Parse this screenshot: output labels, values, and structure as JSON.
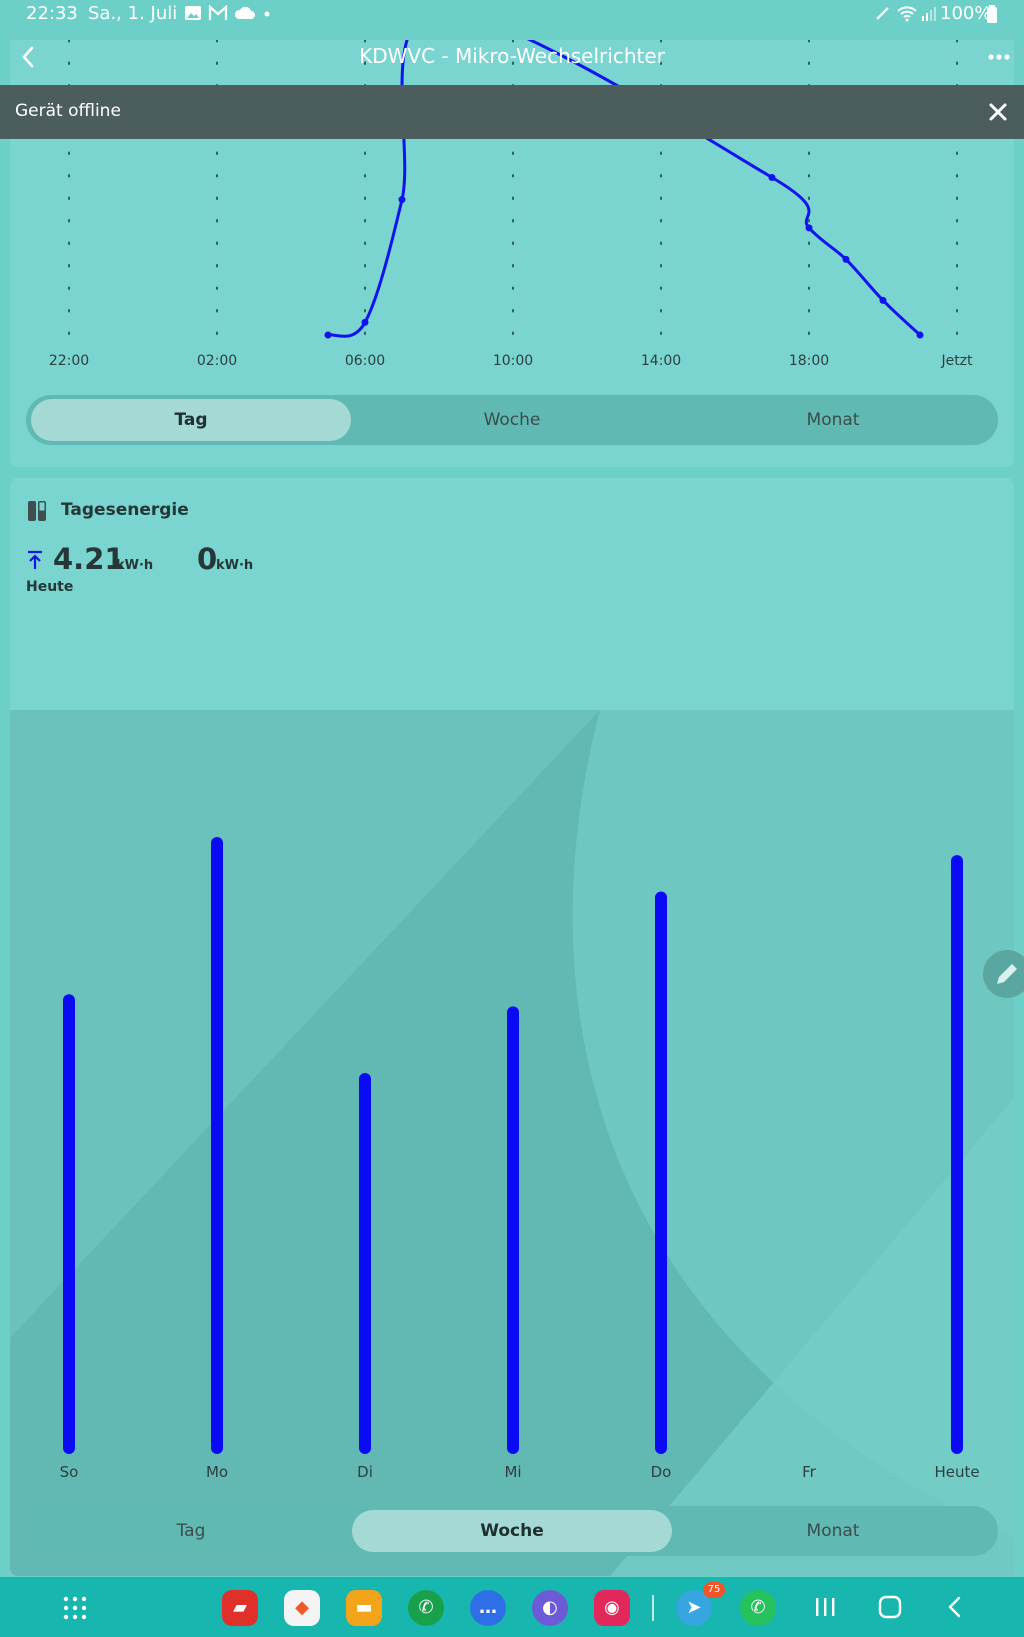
{
  "status_bar": {
    "time": "22:33",
    "date": "Sa., 1. Juli",
    "battery": "100%",
    "icons": [
      "image-icon",
      "mail-icon",
      "cloud-icon",
      "dot-icon",
      "pen-icon",
      "wifi-icon",
      "signal-icon",
      "battery-icon"
    ]
  },
  "header": {
    "title": "KDWVC - Mikro-Wechselrichter",
    "back_icon": "chevron-left-icon",
    "more_icon": "more-icon"
  },
  "banner": {
    "text": "Gerät offline",
    "close_icon": "close-icon"
  },
  "power_chart": {
    "tabs": [
      {
        "label": "Tag",
        "active": true
      },
      {
        "label": "Woche",
        "active": false
      },
      {
        "label": "Monat",
        "active": false
      }
    ]
  },
  "energy_card": {
    "title": "Tagesenergie",
    "icon": "bar-chart-icon",
    "today_value": "4.21",
    "today_unit": "kW·h",
    "today_label": "Heute",
    "today_icon": "arrow-up-to-line-icon",
    "second_value": "0",
    "second_unit": "kW·h",
    "tabs": [
      {
        "label": "Tag",
        "active": false
      },
      {
        "label": "Woche",
        "active": true
      },
      {
        "label": "Monat",
        "active": false
      }
    ],
    "edit_icon": "pencil-icon"
  },
  "chart_data": [
    {
      "type": "line",
      "x_tick_labels": [
        "22:00",
        "02:00",
        "06:00",
        "10:00",
        "14:00",
        "18:00",
        "Jetzt"
      ],
      "x_hours": [
        5.0,
        6.0,
        7.0,
        8.0,
        17.0,
        18.0,
        19.0,
        20.0,
        21.0
      ],
      "y_rel": [
        0.0,
        0.04,
        0.43,
        1.03,
        0.5,
        0.34,
        0.24,
        0.11,
        0.0
      ],
      "color": "#1212ee",
      "grid": true
    },
    {
      "type": "bar",
      "categories": [
        "So",
        "Mo",
        "Di",
        "Mi",
        "Do",
        "Fr",
        "Heute"
      ],
      "values": [
        0.74,
        1.0,
        0.61,
        0.72,
        0.91,
        0,
        0.97
      ],
      "color": "#0a0af5"
    }
  ],
  "nav_bar": {
    "icons": [
      "apps-grid-icon",
      "red-app-icon",
      "brave-icon",
      "files-icon",
      "phone-icon",
      "messages-icon",
      "internet-icon",
      "camera-icon",
      "telegram-icon",
      "whatsapp-icon",
      "recents-icon",
      "home-icon",
      "back-icon"
    ],
    "telegram_badge": "75"
  }
}
